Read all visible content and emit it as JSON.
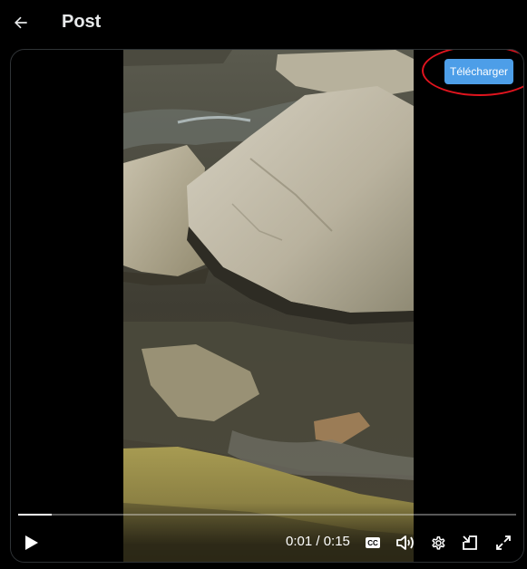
{
  "header": {
    "back_icon": "arrow-left-icon",
    "title": "Post"
  },
  "overlay": {
    "download_label": "Télécharger",
    "download_color": "#4d9ee8",
    "highlight_color": "#e0141e"
  },
  "player": {
    "time_display": "0:01 / 0:15",
    "current_time": "0:01",
    "duration": "0:15",
    "progress_fraction": 0.067,
    "cc_label": "CC",
    "icons": [
      "play-icon",
      "cc-icon",
      "volume-icon",
      "gear-icon",
      "picture-in-picture-icon",
      "fullscreen-icon"
    ]
  }
}
